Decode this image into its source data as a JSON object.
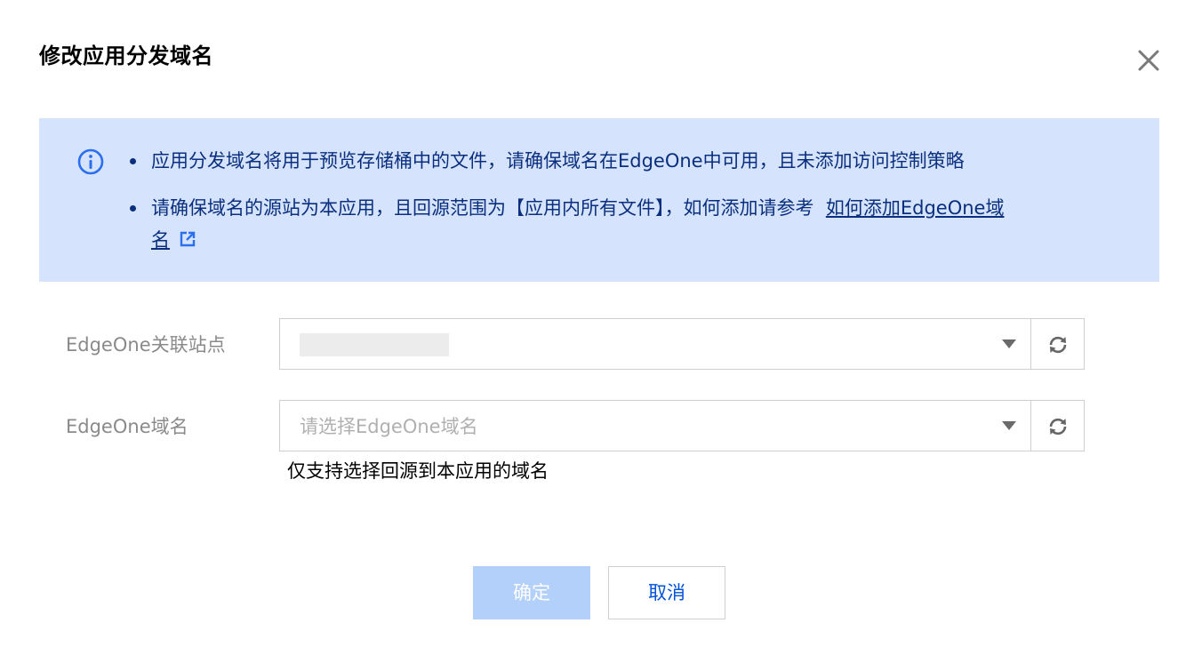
{
  "dialog": {
    "title": "修改应用分发域名"
  },
  "notice": {
    "line1": "应用分发域名将用于预览存储桶中的文件，请确保域名在EdgeOne中可用，且未添加访问控制策略",
    "line2_prefix": "请确保域名的源站为本应用，且回源范围为【应用内所有文件】，如何添加请参考",
    "line2_link": "如何添加EdgeOne域名"
  },
  "form": {
    "site": {
      "label": "EdgeOne关联站点"
    },
    "domain": {
      "label": "EdgeOne域名",
      "placeholder": "请选择EdgeOne域名",
      "help": "仅支持选择回源到本应用的域名"
    }
  },
  "buttons": {
    "ok": "确定",
    "cancel": "取消"
  },
  "colors": {
    "notice_bg": "#d5e4fc",
    "notice_text": "#0b2f7e",
    "primary": "#0052d9",
    "primary_disabled": "#b2d0fa"
  },
  "icons": {
    "close": "close-icon",
    "info": "info-icon",
    "external_link": "external-link-icon",
    "refresh": "refresh-icon",
    "caret": "caret-down-icon"
  }
}
